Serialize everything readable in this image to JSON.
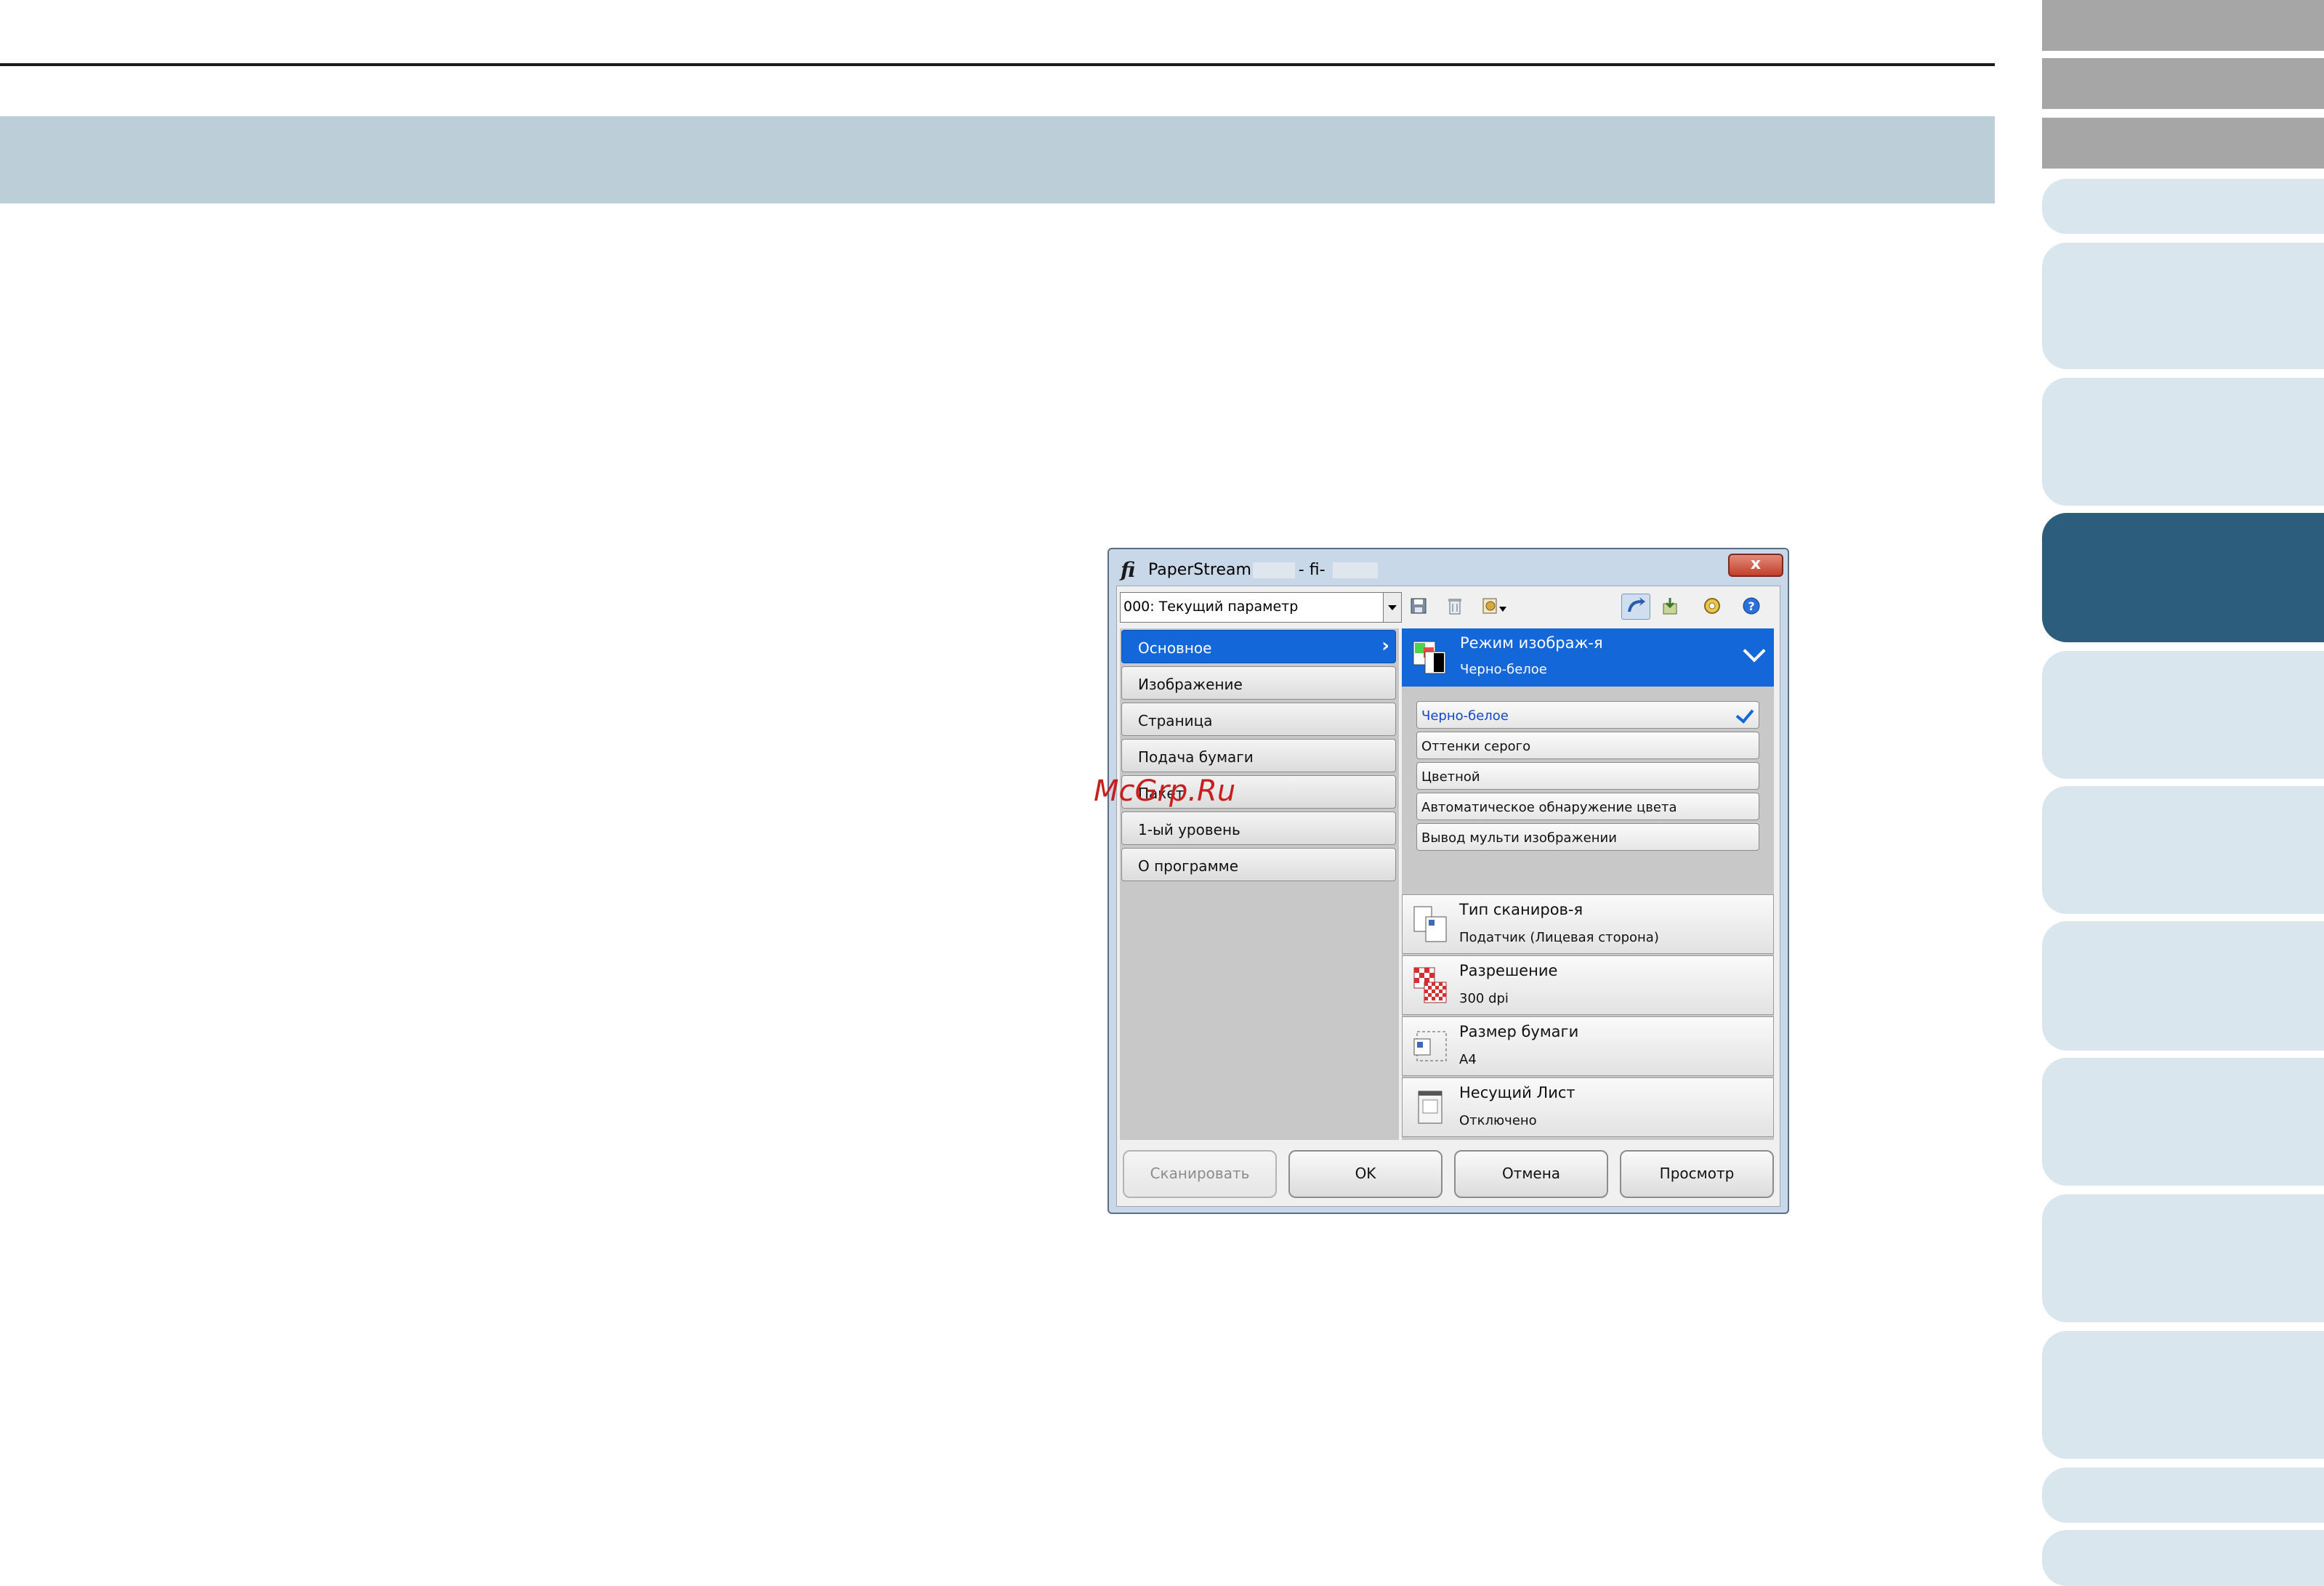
{
  "watermark": "McGrp.Ru",
  "dialog": {
    "logo": "fi",
    "title_text": "PaperStream IP (        ) - fi-",
    "close_label": "x",
    "profile_value": "000: Текущий параметр",
    "menu": [
      {
        "label": "Основное",
        "selected": true
      },
      {
        "label": "Изображение"
      },
      {
        "label": "Страница"
      },
      {
        "label": "Подача бумаги"
      },
      {
        "label": "Пакет"
      },
      {
        "label": "1-ый уровень"
      },
      {
        "label": "О программе"
      }
    ],
    "image_mode": {
      "title": "Режим изображ-я",
      "value": "Черно-белое"
    },
    "options": [
      {
        "label": "Черно-белое",
        "selected": true
      },
      {
        "label": "Оттенки серого"
      },
      {
        "label": "Цветной"
      },
      {
        "label": "Автоматическое обнаружение цвета"
      },
      {
        "label": "Вывод мульти изображении"
      }
    ],
    "settings": [
      {
        "title": "Тип сканиров-я",
        "value": "Податчик (Лицевая сторона)",
        "icon": "scan-type-icon"
      },
      {
        "title": "Разрешение",
        "value": "300 dpi",
        "icon": "resolution-icon"
      },
      {
        "title": "Размер бумаги",
        "value": "A4",
        "icon": "paper-size-icon"
      },
      {
        "title": "Несущий Лист",
        "value": "Отключено",
        "icon": "carrier-sheet-icon"
      }
    ],
    "buttons": {
      "scan": "Сканировать",
      "ok": "OK",
      "cancel": "Отмена",
      "preview": "Просмотр"
    }
  }
}
